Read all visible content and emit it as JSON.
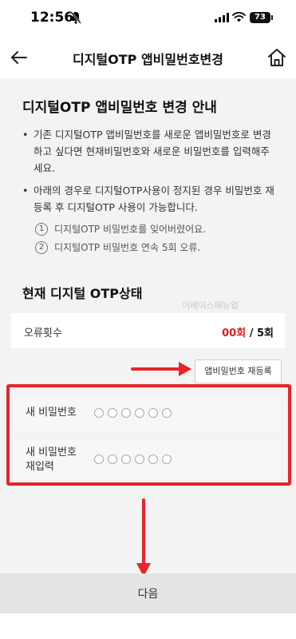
{
  "status_bar": {
    "time": "12:56",
    "battery": "73",
    "icons": [
      "bell-off-icon",
      "signal-icon",
      "wifi-icon",
      "battery-icon"
    ]
  },
  "header": {
    "title": "디지털OTP 앱비밀번호변경",
    "icons": [
      "back-arrow-icon",
      "home-icon"
    ]
  },
  "guide": {
    "title": "디지털OTP 앱비밀번호 변경 안내",
    "bullets": [
      "기존 디지털OTP 앱비밀번호를 새로운 앱비밀번호로 변경하고 싶다면 현재비밀번호와 새로운 비밀번호를 입력해주세요.",
      "아래의 경우로 디지털OTP사용이 정지된 경우 비밀번호 재등록 후 디지털OTP 사용이 가능합니다."
    ],
    "cases": [
      {
        "num": "1",
        "text": "디지털OTP 비밀번호를 잊어버렸어요."
      },
      {
        "num": "2",
        "text": "디지털OTP 비밀번호 연속 5회 오류."
      }
    ]
  },
  "otp_status": {
    "title": "현재 디지털 OTP상태",
    "watermark": "이베이스매뉴얼",
    "error_label": "오류횟수",
    "error_count": "00회",
    "error_separator": " / ",
    "error_max": "5회",
    "reregister_label": "앱비밀번호 재등록"
  },
  "password": {
    "new_label": "새 비밀번호",
    "confirm_label": "새 비밀번호 재입력",
    "pin_length": 6
  },
  "footer": {
    "next_label": "다음"
  },
  "annotation": {
    "color": "#e8232a"
  }
}
